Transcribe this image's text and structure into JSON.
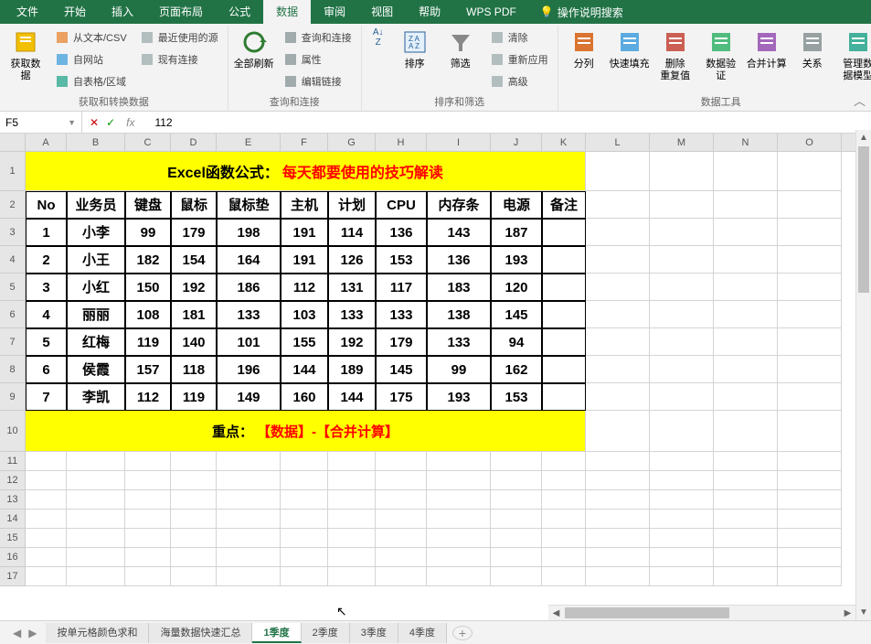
{
  "menu": {
    "tabs": [
      "文件",
      "开始",
      "插入",
      "页面布局",
      "公式",
      "数据",
      "审阅",
      "视图",
      "帮助",
      "WPS PDF"
    ],
    "active": "数据",
    "search": "操作说明搜索"
  },
  "ribbon": {
    "g1": {
      "label": "获取和转换数据",
      "big": "获取数\n据",
      "items": [
        "从文本/CSV",
        "自网站",
        "自表格/区域",
        "最近使用的源",
        "现有连接"
      ]
    },
    "g2": {
      "label": "查询和连接",
      "big": "全部刷新",
      "items": [
        "查询和连接",
        "属性",
        "编辑链接"
      ]
    },
    "g3": {
      "label": "排序和筛选",
      "b1": "排序",
      "b2": "筛选",
      "items": [
        "清除",
        "重新应用",
        "高级"
      ]
    },
    "g4": {
      "label": "数据工具",
      "btns": [
        "分列",
        "快速填充",
        "删除\n重复值",
        "数据验\n证",
        "合并计算",
        "关系",
        "管理数\n据模型"
      ]
    }
  },
  "fbar": {
    "name": "F5",
    "value": "112"
  },
  "cols": [
    "A",
    "B",
    "C",
    "D",
    "E",
    "F",
    "G",
    "H",
    "I",
    "J",
    "K",
    "L",
    "M",
    "N",
    "O"
  ],
  "title": {
    "black": "Excel函数公式：",
    "red": "每天都要使用的技巧解读"
  },
  "headers": [
    "No",
    "业务员",
    "键盘",
    "鼠标",
    "鼠标垫",
    "主机",
    "计划",
    "CPU",
    "内存条",
    "电源",
    "备注"
  ],
  "data": [
    [
      "1",
      "小李",
      "99",
      "179",
      "198",
      "191",
      "114",
      "136",
      "143",
      "187",
      ""
    ],
    [
      "2",
      "小王",
      "182",
      "154",
      "164",
      "191",
      "126",
      "153",
      "136",
      "193",
      ""
    ],
    [
      "3",
      "小红",
      "150",
      "192",
      "186",
      "112",
      "131",
      "117",
      "183",
      "120",
      ""
    ],
    [
      "4",
      "丽丽",
      "108",
      "181",
      "133",
      "103",
      "133",
      "133",
      "138",
      "145",
      ""
    ],
    [
      "5",
      "红梅",
      "119",
      "140",
      "101",
      "155",
      "192",
      "179",
      "133",
      "94",
      ""
    ],
    [
      "6",
      "侯霞",
      "157",
      "118",
      "196",
      "144",
      "189",
      "145",
      "99",
      "162",
      ""
    ],
    [
      "7",
      "李凯",
      "112",
      "119",
      "149",
      "160",
      "144",
      "175",
      "193",
      "153",
      ""
    ]
  ],
  "note": {
    "black": "重点：",
    "red": "【数据】-【合并计算】"
  },
  "sheets": {
    "tabs": [
      "按单元格颜色求和",
      "海量数据快速汇总",
      "1季度",
      "2季度",
      "3季度",
      "4季度"
    ],
    "active": "1季度"
  }
}
